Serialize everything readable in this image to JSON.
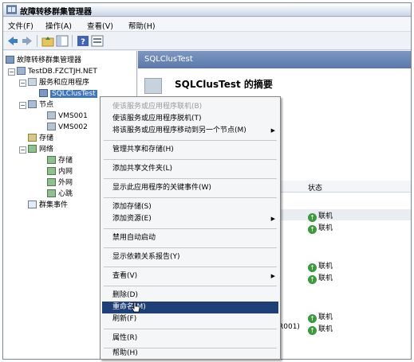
{
  "window": {
    "title": "故障转移群集管理器"
  },
  "menubar": [
    "文件(F)",
    "操作(A)",
    "查看(V)",
    "帮助(H)"
  ],
  "tree": {
    "root": "故障转移群集管理器",
    "cluster": "TestDB.FZCTJH.NET",
    "services": "服务和应用程序",
    "selected": "SQLClusTest",
    "nodes": "节点",
    "node1": "VMS001",
    "node2": "VMS002",
    "storage": "存储",
    "networks": "网络",
    "net_storage": "存储",
    "net_internal": "内网",
    "net_external": "外网",
    "net_heartbeat": "心跳",
    "events": "群集事件"
  },
  "right": {
    "header": "SQLClusTest",
    "summary_title": "SQLClusTest 的摘要",
    "status_column": "状态",
    "status_values": [
      "联机",
      "联机",
      "联机",
      "联机",
      "联机",
      "联机"
    ],
    "resource_fragment": "R001)"
  },
  "context_menu": {
    "items": [
      {
        "label": "使该服务或应用程序联机(B)",
        "disabled": true
      },
      {
        "label": "使该服务或应用程序脱机(T)"
      },
      {
        "label": "将该服务或应用程序移动到另一个节点(M)",
        "submenu": true
      },
      {
        "label": "管理共享和存储(H)"
      },
      {
        "label": "添加共享文件夹(L)"
      },
      {
        "label": "显示此应用程序的关键事件(W)"
      },
      {
        "label": "添加存储(S)"
      },
      {
        "label": "添加资源(E)",
        "submenu": true
      },
      {
        "label": "禁用自动启动"
      },
      {
        "label": "显示依赖关系报告(Y)"
      },
      {
        "label": "查看(V)",
        "submenu": true
      },
      {
        "label": "删除(D)"
      },
      {
        "label": "重命名(M)",
        "highlighted": true
      },
      {
        "label": "刷新(F)"
      },
      {
        "label": "属性(R)"
      },
      {
        "label": "帮助(H)"
      }
    ]
  },
  "colors": {
    "selection": "#3c74c6",
    "menu_highlight": "#1f3f78",
    "online_green": "#3d9a3d",
    "header_blue": "#5a78ab"
  },
  "icons": [
    "back-icon",
    "forward-icon",
    "up-folder-icon",
    "show-hide-tree-icon",
    "help-icon",
    "properties-icon",
    "cluster-icon",
    "online-icon"
  ]
}
